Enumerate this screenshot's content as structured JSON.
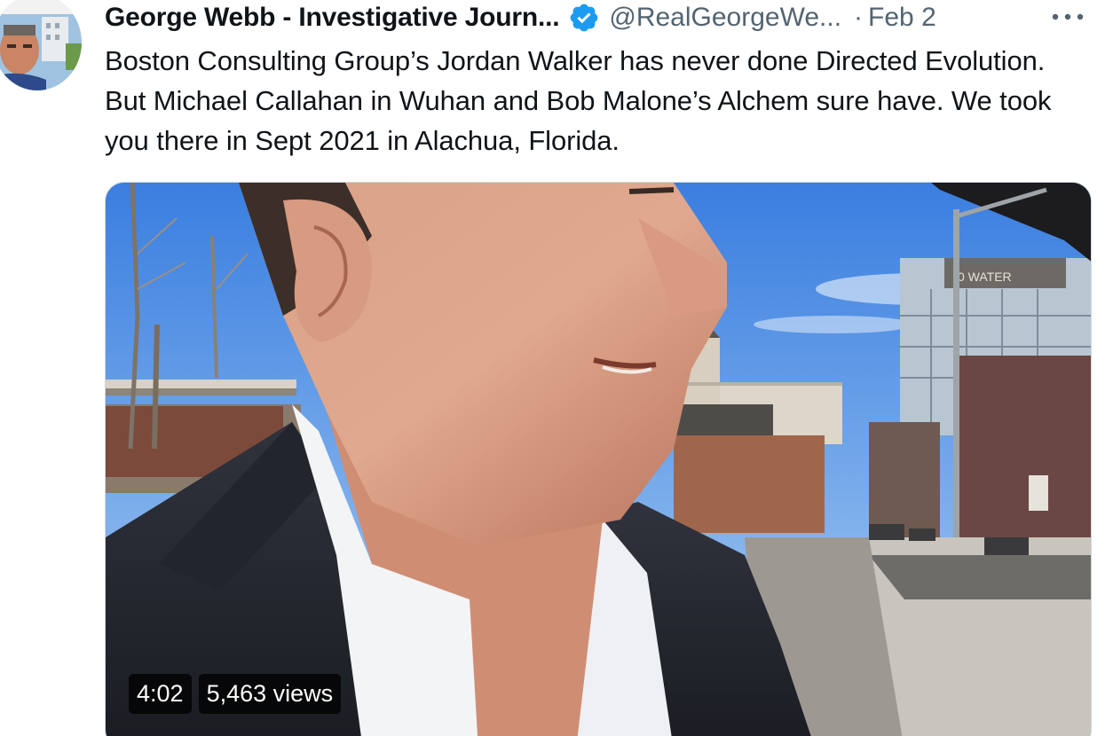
{
  "tweet": {
    "author_name": "George Webb - Investigative Journ...",
    "handle": "@RealGeorgeWe...",
    "separator": "·",
    "date": "Feb 2",
    "more_label": "···",
    "text": "Boston Consulting Group’s Jordan Walker has never done Directed Evolution. But Michael Callahan in Wuhan and Bob Malone’s Alchem sure have. We took you there in Sept 2021 in Alachua, Florida."
  },
  "video": {
    "duration": "4:02",
    "views": "5,463 views",
    "building_sign": "0 WATER"
  },
  "icons": {
    "verified": "verified-badge-icon",
    "more": "more-options-icon"
  },
  "colors": {
    "verified_blue": "#1d9bf0",
    "secondary_text": "#536471",
    "primary_text": "#0f1419"
  }
}
